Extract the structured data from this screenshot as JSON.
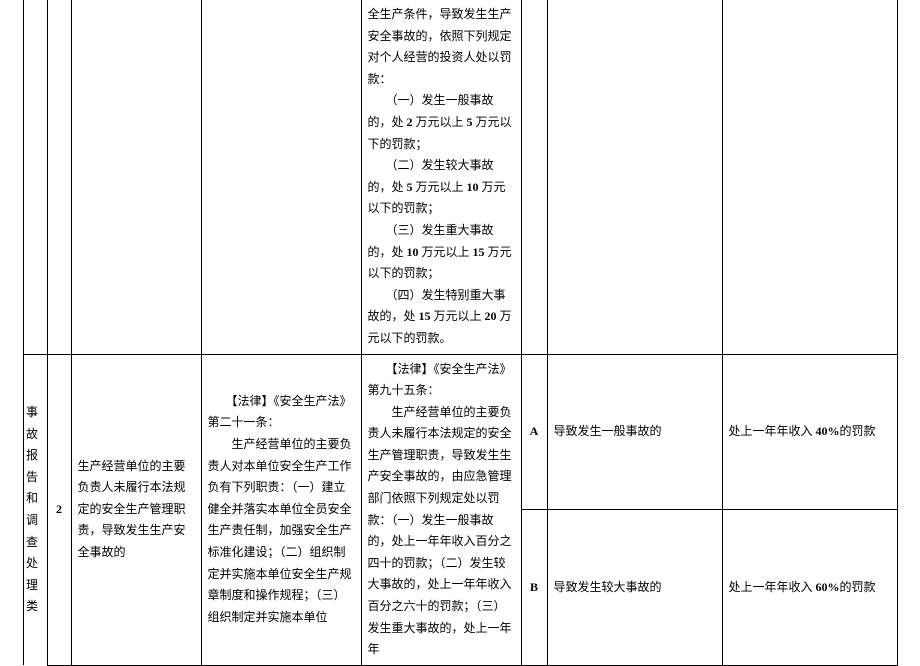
{
  "row1": {
    "law2_text": "全生产条件，导致发生生产安全事故的，依照下列规定对个人经营的投资人处以罚款：\n　　（一）发生一般事故的，处 2 万元以上 5 万元以下的罚款；\n　　（二）发生较大事故的，处 5 万元以上 10 万元以下的罚款；\n　　（三）发生重大事故的，处 10 万元以上 15 万元以下的罚款；\n　　（四）发生特别重大事故的，处 15 万元以上 20 万元以下的罚款。"
  },
  "category": "事故报告和调查处理类",
  "row2": {
    "num": "2",
    "desc": "生产经营单位的主要负责人未履行本法规定的安全生产管理职责，导致发生生产安全事故的",
    "law1": "　　【法律】《安全生产法》第二十一条：\n　　生产经营单位的主要负责人对本单位安全生产工作负有下列职责：（一）建立健全并落实本单位全员安全生产责任制，加强安全生产标准化建设；（二）组织制定并实施本单位安全生产规章制度和操作规程；（三）组织制定并实施本单位",
    "law2": "　　【法律】《安全生产法》第九十五条：\n　　生产经营单位的主要负责人未履行本法规定的安全生产管理职责，导致发生生产安全事故的，由应急管理部门依照下列规定处以罚款：（一）发生一般事故的，处上一年年收入百分之四十的罚款；（二）发生较大事故的，处上一年年收入百分之六十的罚款；（三）发生重大事故的，处上一年年",
    "levels": [
      {
        "code": "A",
        "situation": "导致发生一般事故的",
        "penalty": "处上一年年收入 40%的罚款"
      },
      {
        "code": "B",
        "situation": "导致发生较大事故的",
        "penalty": "处上一年年收入 60%的罚款"
      }
    ]
  }
}
